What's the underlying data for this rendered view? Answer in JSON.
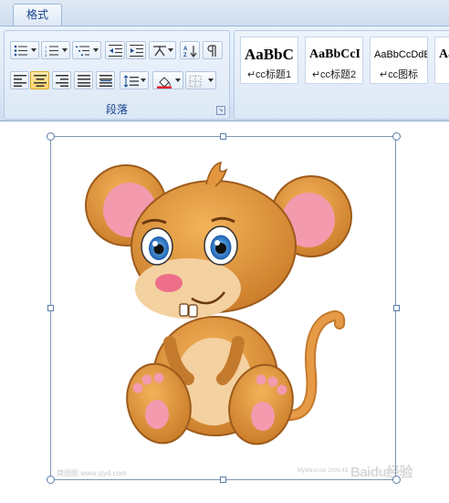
{
  "ribbon": {
    "tab_label": "格式",
    "paragraph_group_label": "段落",
    "styles": [
      {
        "preview": "AaBbC",
        "name": "cc标题1",
        "bold": true,
        "size": 17
      },
      {
        "preview": "AaBbCcI",
        "name": "cc标题2",
        "bold": true,
        "size": 14
      },
      {
        "preview": "AaBbCcDdE",
        "name": "cc图标",
        "bold": false,
        "size": 12
      },
      {
        "preview": "AaB",
        "name": "",
        "bold": true,
        "size": 14
      }
    ],
    "paragraph_mark": "↵"
  },
  "document": {
    "image_alt": "cartoon mouse",
    "watermark_left": "简图图 www.sjyd.com",
    "watermark_right": "Baidu经验",
    "watermark_small_right": "MyWind.net 2009.43"
  },
  "colors": {
    "ribbon_text": "#15428b",
    "selection_border": "#7f96b2",
    "mouse_fur": "#d98f3a",
    "mouse_belly": "#f4d1a0",
    "ear_inner": "#f39aae"
  }
}
